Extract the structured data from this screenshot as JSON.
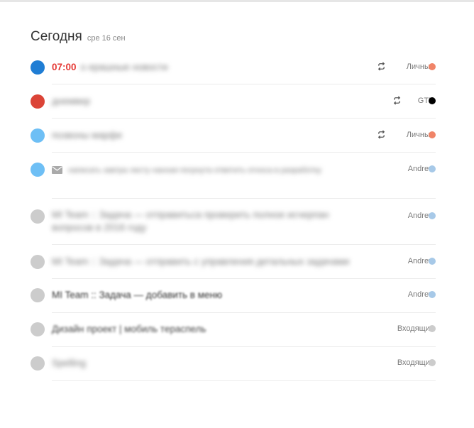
{
  "header": {
    "title": "Сегодня",
    "date": "сре 16 сен"
  },
  "tasks": [
    {
      "time": "07:00",
      "text": "о ерашные новости",
      "project": "Личные",
      "repeat": true,
      "project_color": "#f08468",
      "check_color": "#1f7dd4"
    },
    {
      "time": "",
      "text": "днемвер",
      "project": "GTD",
      "repeat": true,
      "project_color": "#000000",
      "check_color": "#db4437"
    },
    {
      "time": "",
      "text": "позвоны марфе",
      "project": "Личные",
      "repeat": true,
      "project_color": "#f08468",
      "check_color": "#6ebff5"
    },
    {
      "time": "",
      "text": "написать завтра листу нанная погрнута ответить относа в разработку",
      "project": "Andrew",
      "repeat": false,
      "mail": true,
      "project_color": "#a7c9e8",
      "check_color": "#6ebff5"
    },
    {
      "time": "",
      "text": "MI Team :: Задача — отправитьса проверить полное исчерпан вопросов в 2016 году",
      "project": "Andrew",
      "repeat": false,
      "project_color": "#a7c9e8",
      "check_color": "#cccccc"
    },
    {
      "time": "",
      "text": "MI Team :: Задача — отправить с управления детальных задачами",
      "project": "Andrew",
      "repeat": false,
      "project_color": "#a7c9e8",
      "check_color": "#cccccc"
    },
    {
      "time": "",
      "text": "MI Team :: Задача — добавить в меню",
      "project": "Andrew",
      "repeat": false,
      "project_color": "#a7c9e8",
      "check_color": "#cccccc"
    },
    {
      "time": "",
      "text": "Дизайн проект | мобиль тераспель",
      "project": "Входящие",
      "repeat": false,
      "project_color": "#cccccc",
      "check_color": "#cccccc"
    },
    {
      "time": "",
      "text": "Spelling",
      "project": "Входящие",
      "repeat": false,
      "project_color": "#cccccc",
      "check_color": "#cccccc"
    }
  ]
}
